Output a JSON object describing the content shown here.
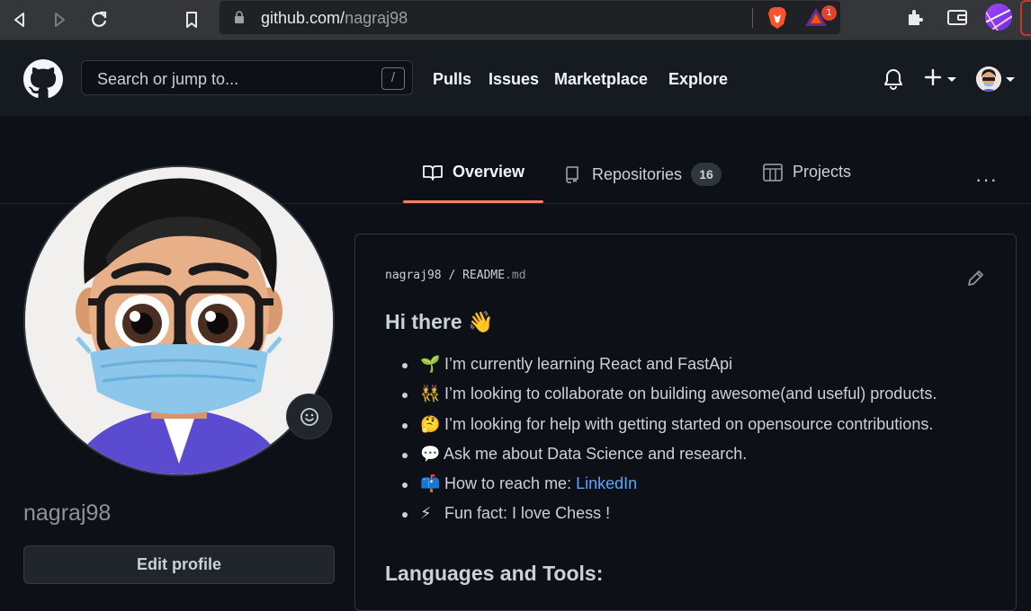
{
  "browser": {
    "url_host": "github.com/",
    "url_path": "nagraj98",
    "bat_badge_count": "1"
  },
  "header": {
    "search_placeholder": "Search or jump to...",
    "search_shortcut": "/",
    "nav": [
      "Pulls",
      "Issues",
      "Marketplace",
      "Explore"
    ]
  },
  "tabs": {
    "overview": "Overview",
    "repositories": "Repositories",
    "repositories_count": "16",
    "projects": "Projects",
    "more": "···"
  },
  "profile": {
    "username": "nagraj98",
    "edit_label": "Edit profile"
  },
  "readme": {
    "owner": "nagraj98",
    "separator": "/",
    "file_name": "README",
    "file_ext": ".md",
    "heading": "Hi there 👋",
    "items": [
      {
        "emoji": "🌱",
        "text": "I’m currently learning React and FastApi"
      },
      {
        "emoji": "👯",
        "text": "I’m looking to collaborate on building awesome(and useful) products."
      },
      {
        "emoji": "🤔",
        "text": "I’m looking for help with getting started on opensource contributions."
      },
      {
        "emoji": "💬",
        "text": "Ask me about Data Science and research."
      },
      {
        "emoji": "📫",
        "text": "How to reach me: ",
        "link": "LinkedIn"
      },
      {
        "emoji": "⚡",
        "text": "Fun fact: I love Chess !"
      }
    ],
    "subheading": "Languages and Tools:"
  },
  "colors": {
    "accent_underline": "#f78166",
    "link": "#58a6ff",
    "background": "#0d1117"
  }
}
